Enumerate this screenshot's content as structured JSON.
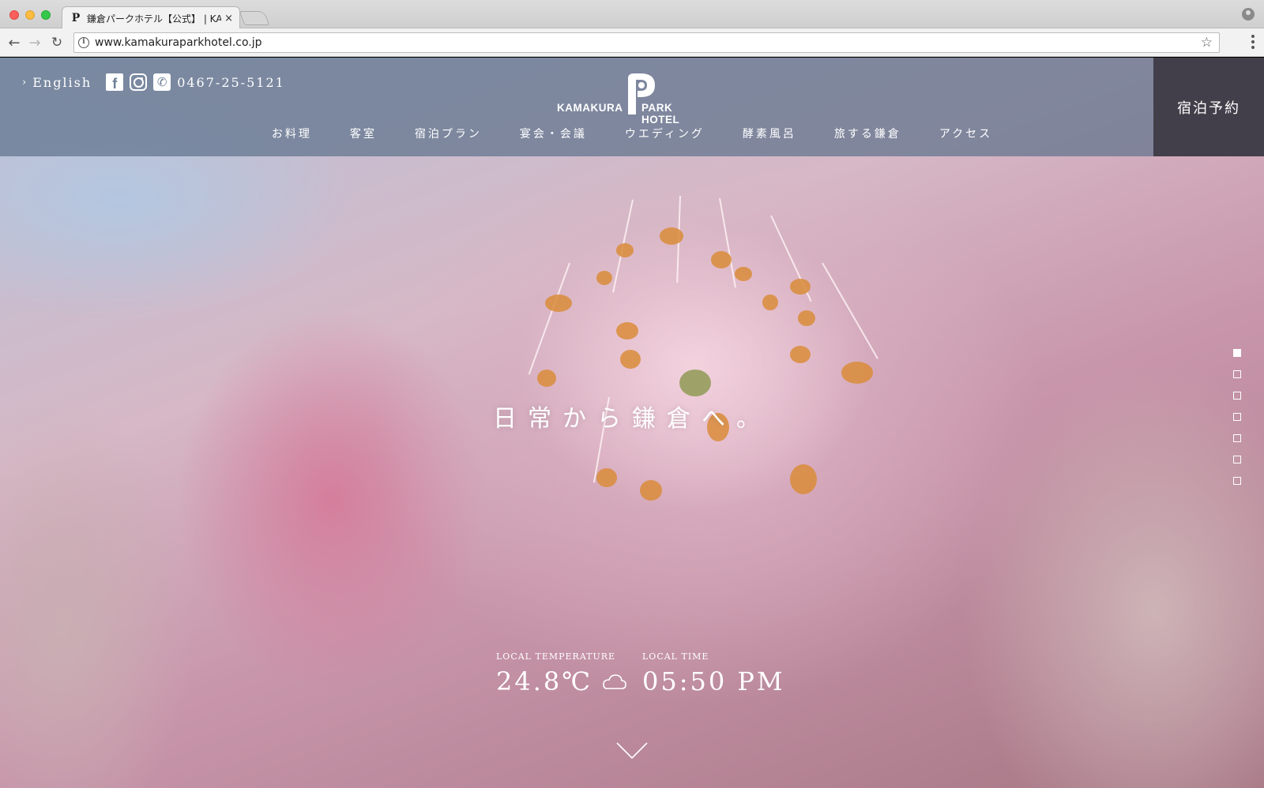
{
  "browser": {
    "tab_title": "鎌倉パークホテル【公式】 | KA",
    "tab_close": "×",
    "url": "www.kamakuraparkhotel.co.jp",
    "back": "←",
    "forward": "→",
    "reload": "↻",
    "star": "☆"
  },
  "header": {
    "lang_chevron": "›",
    "lang": "English",
    "fb": "f",
    "tel_glyph": "✆",
    "phone": "0467-25-5121",
    "logo_left": "KAMAKURA",
    "logo_right": "PARK HOTEL",
    "reserve": "宿泊予約"
  },
  "nav": {
    "items": [
      "お料理",
      "客室",
      "宿泊プラン",
      "宴会・会議",
      "ウエディング",
      "酵素風呂",
      "旅する鎌倉",
      "アクセス"
    ]
  },
  "hero": {
    "copy": "日常から鎌倉へ。",
    "slide_count": 7,
    "active_slide": 1
  },
  "local": {
    "temp_label": "LOCAL TEMPERATURE",
    "temp_value": "24.8℃",
    "weather_icon": "cloud-icon",
    "time_label": "LOCAL TIME",
    "time_value": "05:50 PM"
  },
  "colors": {
    "header_bg": "#5f738c",
    "reserve_bg": "#37323c",
    "text": "#ffffff"
  }
}
